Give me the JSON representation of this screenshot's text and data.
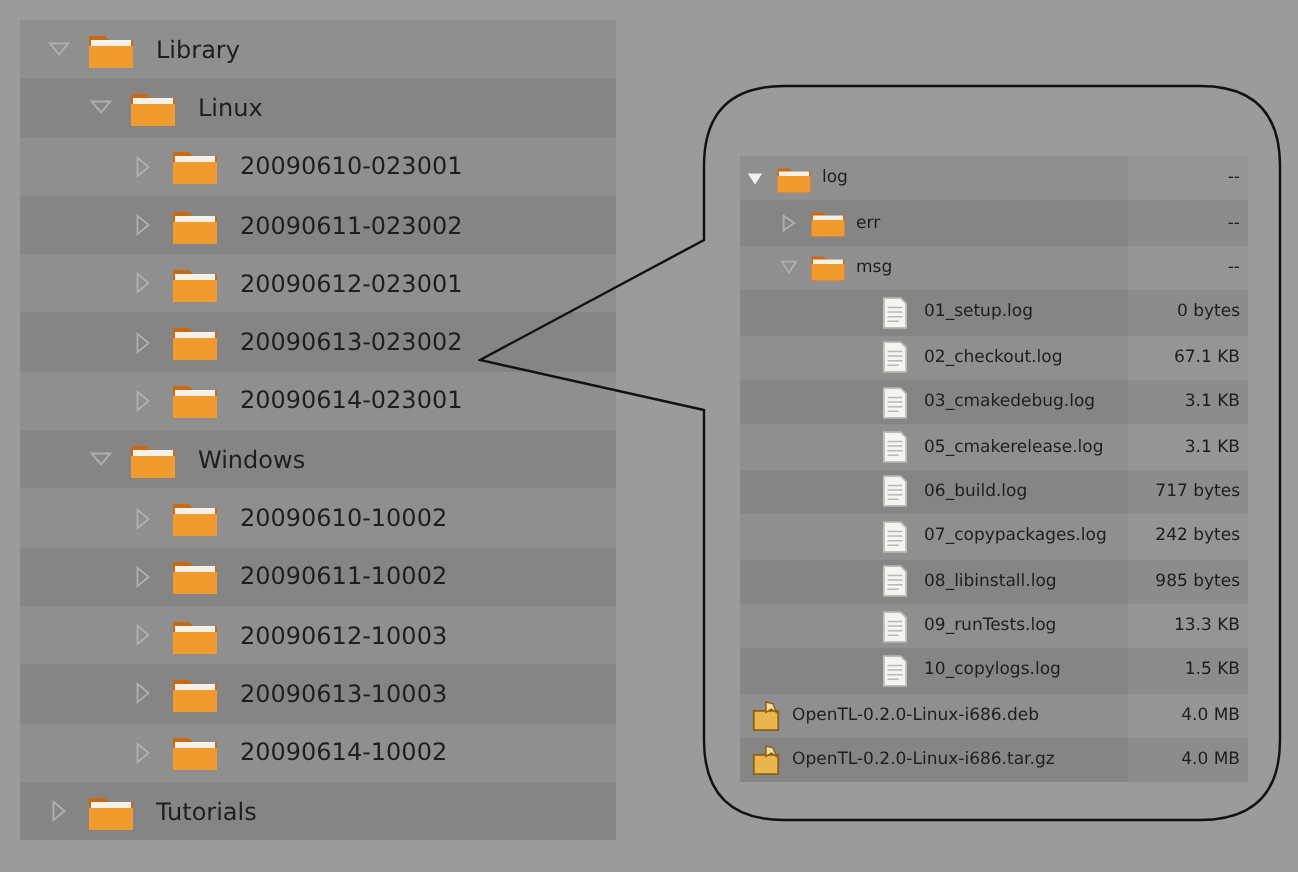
{
  "library_tree": [
    {
      "kind": "folder",
      "label": "Library",
      "expanded": true,
      "children": [
        {
          "kind": "folder",
          "label": "Linux",
          "expanded": true,
          "children": [
            {
              "kind": "folder",
              "label": "20090610-023001",
              "expanded": false
            },
            {
              "kind": "folder",
              "label": "20090611-023002",
              "expanded": false
            },
            {
              "kind": "folder",
              "label": "20090612-023001",
              "expanded": false
            },
            {
              "kind": "folder",
              "label": "20090613-023002",
              "expanded": false
            },
            {
              "kind": "folder",
              "label": "20090614-023001",
              "expanded": false
            }
          ]
        },
        {
          "kind": "folder",
          "label": "Windows",
          "expanded": true,
          "children": [
            {
              "kind": "folder",
              "label": "20090610-10002",
              "expanded": false
            },
            {
              "kind": "folder",
              "label": "20090611-10002",
              "expanded": false
            },
            {
              "kind": "folder",
              "label": "20090612-10003",
              "expanded": false
            },
            {
              "kind": "folder",
              "label": "20090613-10003",
              "expanded": false
            },
            {
              "kind": "folder",
              "label": "20090614-10002",
              "expanded": false
            }
          ]
        }
      ]
    },
    {
      "kind": "folder",
      "label": "Tutorials",
      "expanded": false
    }
  ],
  "detail_tree": [
    {
      "kind": "folder",
      "label": "log",
      "size": "--",
      "expanded": true,
      "children": [
        {
          "kind": "folder",
          "label": "err",
          "size": "--",
          "expanded": false
        },
        {
          "kind": "folder",
          "label": "msg",
          "size": "--",
          "expanded": true,
          "children": [
            {
              "kind": "file",
              "label": "01_setup.log",
              "size": "0 bytes"
            },
            {
              "kind": "file",
              "label": "02_checkout.log",
              "size": "67.1 KB"
            },
            {
              "kind": "file",
              "label": "03_cmakedebug.log",
              "size": "3.1 KB"
            },
            {
              "kind": "file",
              "label": "05_cmakerelease.log",
              "size": "3.1 KB"
            },
            {
              "kind": "file",
              "label": "06_build.log",
              "size": "717 bytes"
            },
            {
              "kind": "file",
              "label": "07_copypackages.log",
              "size": "242 bytes"
            },
            {
              "kind": "file",
              "label": "08_libinstall.log",
              "size": "985 bytes"
            },
            {
              "kind": "file",
              "label": "09_runTests.log",
              "size": "13.3 KB"
            },
            {
              "kind": "file",
              "label": "10_copylogs.log",
              "size": "1.5 KB"
            }
          ]
        }
      ]
    },
    {
      "kind": "package",
      "label": "OpenTL-0.2.0-Linux-i686.deb",
      "size": "4.0 MB"
    },
    {
      "kind": "package",
      "label": "OpenTL-0.2.0-Linux-i686.tar.gz",
      "size": "4.0 MB"
    }
  ]
}
